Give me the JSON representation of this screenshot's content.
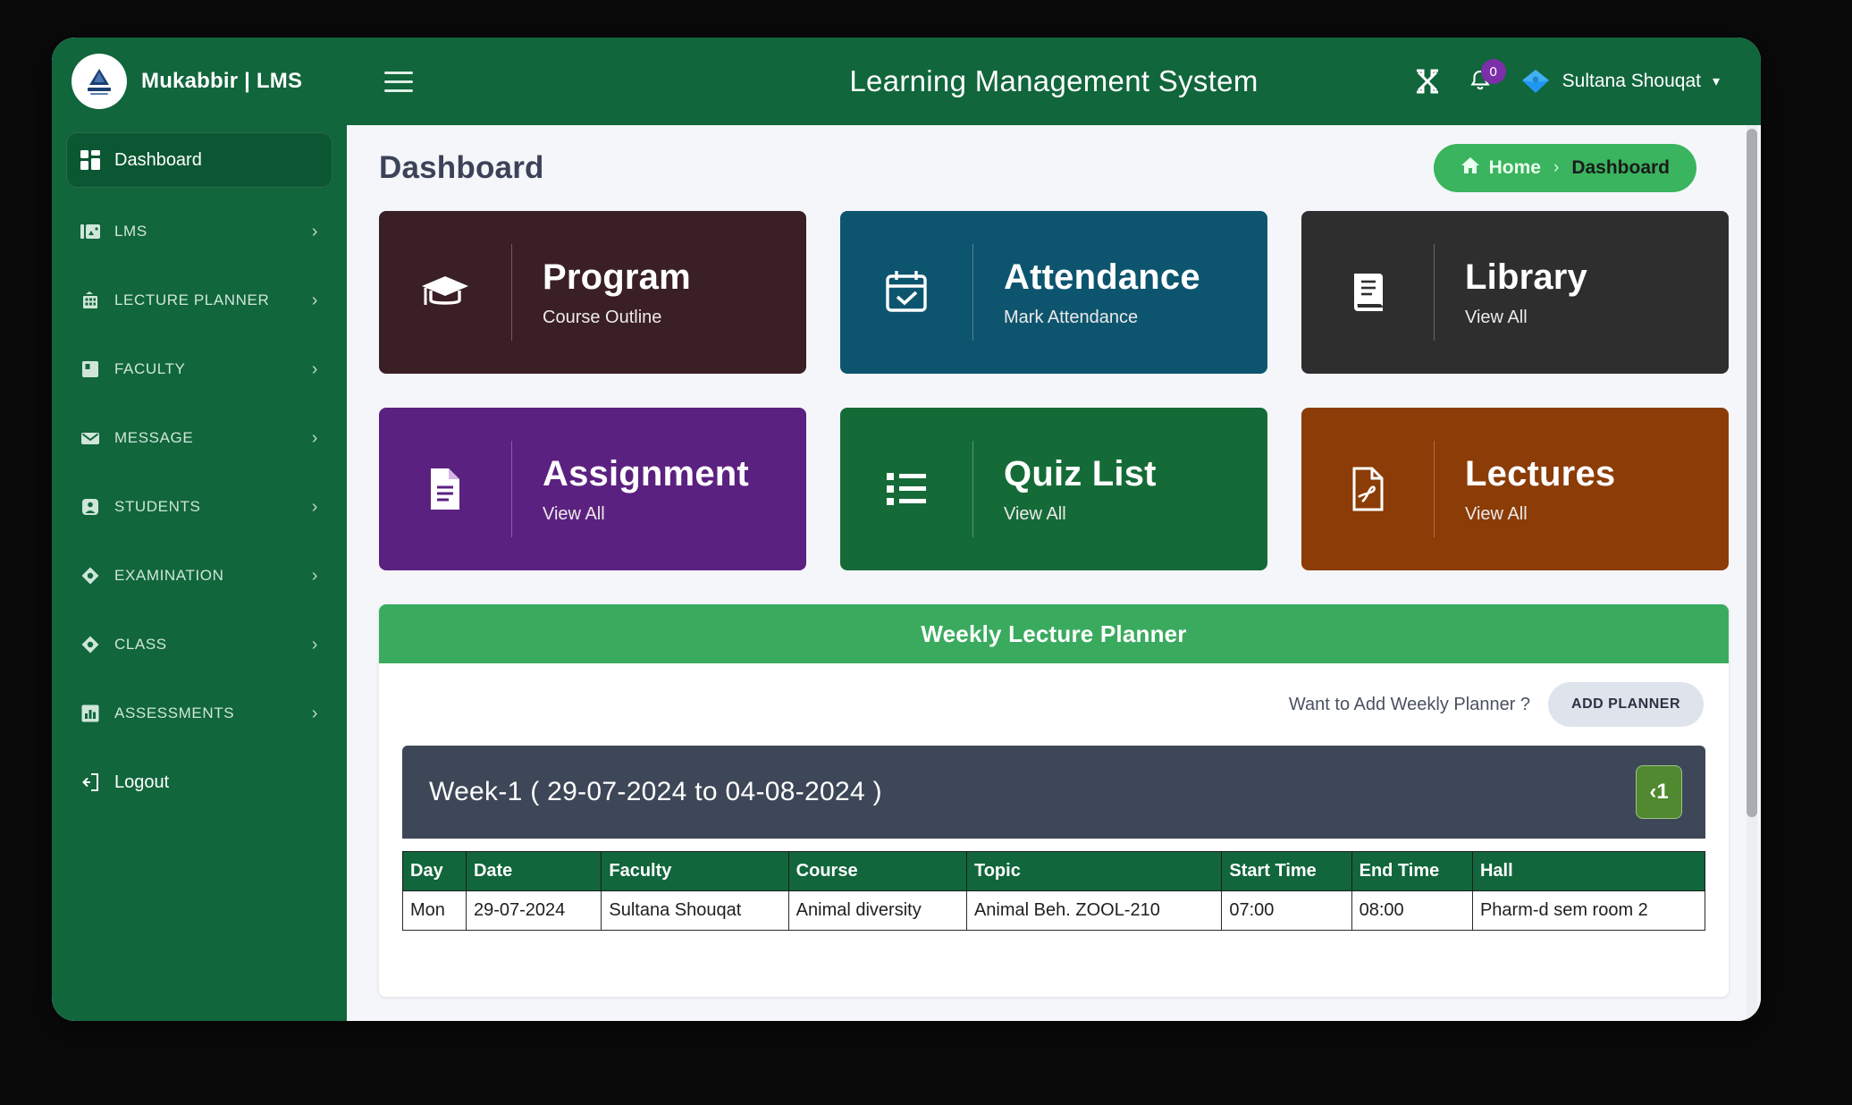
{
  "brand": {
    "title": "Mukabbir | LMS",
    "logo_icon": "pyramid-logo-icon"
  },
  "topbar": {
    "menu_icon": "hamburger-icon",
    "title": "Learning Management System",
    "fullscreen_icon": "fullscreen-expand-icon",
    "notification_icon": "bell-icon",
    "notification_count": "0",
    "user_name": "Sultana Shouqat",
    "user_avatar_icon": "diamond-avatar-icon",
    "user_caret_icon": "chevron-down-icon"
  },
  "sidebar": {
    "items": [
      {
        "label": "Dashboard",
        "icon": "grid-dashboard-icon",
        "active": true,
        "caret": false
      },
      {
        "label": "LMS",
        "icon": "image-panel-icon",
        "active": false,
        "caret": true
      },
      {
        "label": "LECTURE PLANNER",
        "icon": "building-icon",
        "active": false,
        "caret": true
      },
      {
        "label": "FACULTY",
        "icon": "board-icon",
        "active": false,
        "caret": true
      },
      {
        "label": "MESSAGE",
        "icon": "envelope-icon",
        "active": false,
        "caret": true
      },
      {
        "label": "STUDENTS",
        "icon": "user-plus-icon",
        "active": false,
        "caret": true
      },
      {
        "label": "EXAMINATION",
        "icon": "diamond-icon",
        "active": false,
        "caret": true
      },
      {
        "label": "CLASS",
        "icon": "diamond-icon",
        "active": false,
        "caret": true
      },
      {
        "label": "ASSESSMENTS",
        "icon": "bar-chart-icon",
        "active": false,
        "caret": true
      },
      {
        "label": "Logout",
        "icon": "logout-icon",
        "active": false,
        "caret": false
      }
    ],
    "caret_glyph": "›"
  },
  "page": {
    "title": "Dashboard",
    "breadcrumb": {
      "home_label": "Home",
      "home_icon": "home-icon",
      "separator": "›",
      "current_label": "Dashboard"
    }
  },
  "cards": [
    {
      "title": "Program",
      "subtitle": "Course Outline",
      "color": "#3a1f24",
      "icon": "graduation-cap-icon"
    },
    {
      "title": "Attendance",
      "subtitle": "Mark Attendance",
      "color": "#0d556f",
      "icon": "calendar-check-icon"
    },
    {
      "title": "Library",
      "subtitle": "View All",
      "color": "#2e2e2e",
      "icon": "book-icon"
    },
    {
      "title": "Assignment",
      "subtitle": "View All",
      "color": "#5b2180",
      "icon": "file-lines-icon"
    },
    {
      "title": "Quiz List",
      "subtitle": "View All",
      "color": "#156b37",
      "icon": "list-ul-icon"
    },
    {
      "title": "Lectures",
      "subtitle": "View All",
      "color": "#8c3c06",
      "icon": "file-pdf-icon"
    }
  ],
  "planner": {
    "header": "Weekly Lecture Planner",
    "prompt": "Want to Add Weekly Planner ?",
    "add_button": "ADD PLANNER",
    "week_title": "Week-1 ( 29-07-2024 to 04-08-2024 )",
    "week_nav_label": "‹1",
    "columns": [
      "Day",
      "Date",
      "Faculty",
      "Course",
      "Topic",
      "Start Time",
      "End Time",
      "Hall"
    ],
    "rows": [
      {
        "day": "Mon",
        "date": "29-07-2024",
        "faculty": "Sultana Shouqat",
        "course": "Animal diversity",
        "topic": "Animal Beh. ZOOL-210",
        "start_time": "07:00",
        "end_time": "08:00",
        "hall": "Pharm-d sem room 2"
      }
    ]
  },
  "colors": {
    "brand_green": "#11663c",
    "accent_green": "#3ab45e",
    "planner_header": "#3aab5e",
    "week_header": "#3d4757",
    "nav_button": "#50892f",
    "badge_purple": "#7b2fa8"
  }
}
